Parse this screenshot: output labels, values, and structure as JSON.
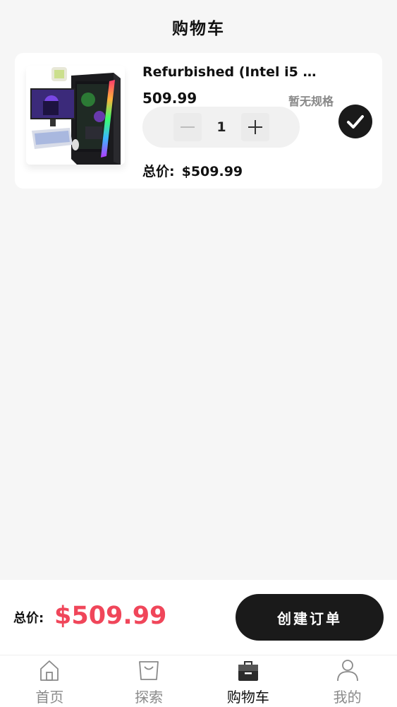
{
  "header": {
    "title": "购物车"
  },
  "cart": {
    "items": [
      {
        "title": "Refurbished (Intel i5 2...",
        "price": "509.99",
        "spec": "暂无规格",
        "quantity": "1",
        "subtotal_label": "总价:",
        "subtotal_value": "$509.99",
        "selected": true,
        "image_icon": "gaming-pc-image"
      }
    ]
  },
  "footer": {
    "total_label": "总价:",
    "total_value": "$509.99",
    "order_button": "创建订单",
    "accent_color": "#f0465a"
  },
  "tabbar": {
    "tabs": [
      {
        "label": "首页",
        "icon": "home-icon",
        "active": false
      },
      {
        "label": "探索",
        "icon": "shopping-bag-icon",
        "active": false
      },
      {
        "label": "购物车",
        "icon": "cart-bag-icon",
        "active": true
      },
      {
        "label": "我的",
        "icon": "user-icon",
        "active": false
      }
    ]
  }
}
